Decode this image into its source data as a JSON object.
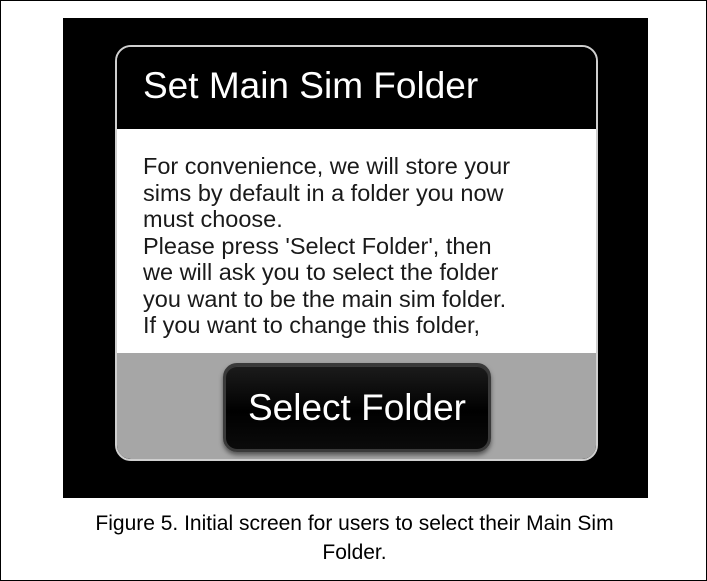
{
  "dialog": {
    "title": "Set Main Sim Folder",
    "message_lines": [
      "For convenience, we will store your",
      "sims by default in a folder you now",
      "must choose.",
      "Please press 'Select Folder', then",
      "we will ask you to select the folder",
      "you want to be the main sim folder.",
      "If you want to change this folder,"
    ],
    "button_label": "Select Folder"
  },
  "caption": {
    "line1": "Figure 5. Initial screen for users to select their Main Sim",
    "line2": "Folder."
  }
}
